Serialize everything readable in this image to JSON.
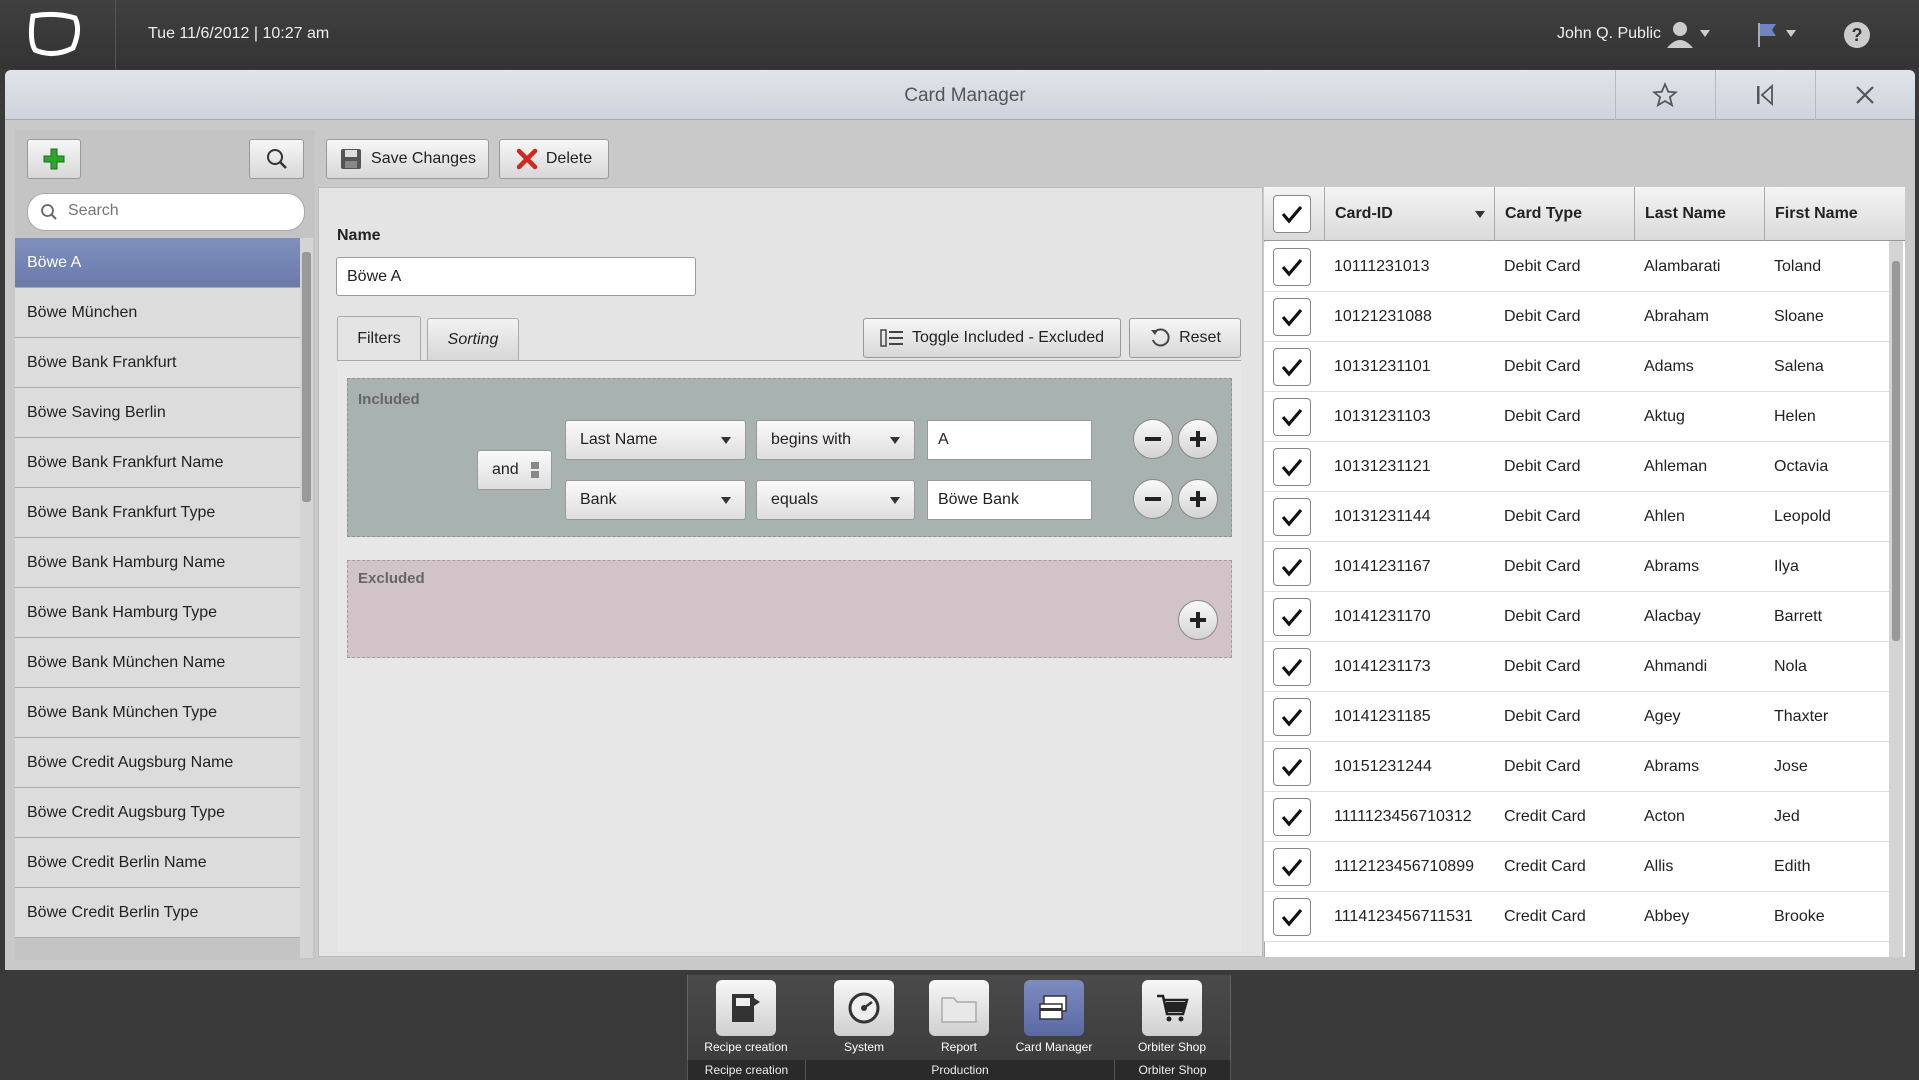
{
  "topbar": {
    "datetime": "Tue 11/6/2012  |  10:27 am",
    "user": "John Q. Public"
  },
  "window": {
    "title": "Card Manager"
  },
  "toolbar": {
    "save_label": "Save Changes",
    "delete_label": "Delete"
  },
  "sidebar": {
    "search_placeholder": "Search",
    "items": [
      "Böwe A",
      "Böwe München",
      "Böwe Bank Frankfurt",
      "Böwe Saving Berlin",
      "Böwe Bank Frankfurt Name",
      "Böwe Bank Frankfurt Type",
      "Böwe Bank Hamburg Name",
      "Böwe Bank Hamburg Type",
      "Böwe Bank München Name",
      "Böwe Bank München Type",
      "Böwe Credit Augsburg Name",
      "Böwe Credit Augsburg Type",
      "Böwe Credit Berlin Name",
      "Böwe Credit Berlin Type"
    ]
  },
  "form": {
    "name_label": "Name",
    "name_value": "Böwe A",
    "tabs": [
      "Filters",
      "Sorting"
    ],
    "toggle_label": "Toggle Included - Excluded",
    "reset_label": "Reset",
    "included_label": "Included",
    "excluded_label": "Excluded",
    "operator": "and",
    "rules": [
      {
        "field": "Last Name",
        "op": "begins with",
        "value": "A"
      },
      {
        "field": "Bank",
        "op": "equals",
        "value": "Böwe Bank"
      }
    ]
  },
  "table": {
    "columns": [
      "Card-ID",
      "Card Type",
      "Last Name",
      "First Name"
    ],
    "rows": [
      [
        "10111231013",
        "Debit Card",
        "Alambarati",
        "Toland"
      ],
      [
        "10121231088",
        "Debit Card",
        "Abraham",
        "Sloane"
      ],
      [
        "10131231101",
        "Debit Card",
        "Adams",
        "Salena"
      ],
      [
        "10131231103",
        "Debit Card",
        "Aktug",
        "Helen"
      ],
      [
        "10131231121",
        "Debit Card",
        "Ahleman",
        "Octavia"
      ],
      [
        "10131231144",
        "Debit Card",
        "Ahlen",
        "Leopold"
      ],
      [
        "10141231167",
        "Debit Card",
        "Abrams",
        "Ilya"
      ],
      [
        "10141231170",
        "Debit Card",
        "Alacbay",
        "Barrett"
      ],
      [
        "10141231173",
        "Debit Card",
        "Ahmandi",
        "Nola"
      ],
      [
        "10141231185",
        "Debit Card",
        "Agey",
        "Thaxter"
      ],
      [
        "10151231244",
        "Debit Card",
        "Abrams",
        "Jose"
      ],
      [
        "1111123456710312",
        "Credit Card",
        "Acton",
        "Jed"
      ],
      [
        "1112123456710899",
        "Credit Card",
        "Allis",
        "Edith"
      ],
      [
        "1114123456711531",
        "Credit Card",
        "Abbey",
        "Brooke"
      ]
    ]
  },
  "dock": {
    "items": [
      "Recipe creation",
      "System",
      "Report",
      "Card Manager",
      "Orbiter Shop"
    ],
    "groups": [
      "Recipe creation",
      "Production",
      "Orbiter Shop"
    ]
  },
  "colors": {
    "accent": "#6a7aab",
    "included_bg": "#a8b2b0",
    "excluded_bg": "#d2c3c8",
    "add_green": "#2fa52f",
    "delete_red": "#d0281e"
  }
}
